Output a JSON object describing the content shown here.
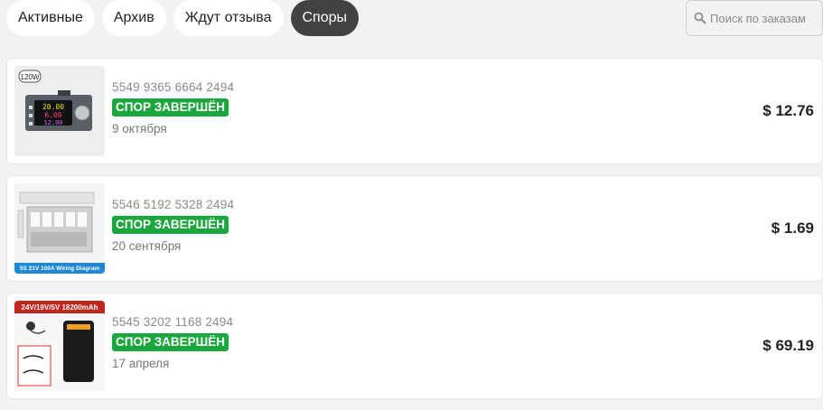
{
  "tabs": [
    {
      "label": "Активные"
    },
    {
      "label": "Архив"
    },
    {
      "label": "Ждут отзыва"
    },
    {
      "label": "Споры"
    }
  ],
  "search": {
    "placeholder": "Поиск по заказам"
  },
  "orders": [
    {
      "number": "5549 9365 6664 2494",
      "status": "СПОР ЗАВЕРШЁН",
      "date": "9 октября",
      "price": "$ 12.76",
      "image_label": "120W",
      "image_readouts": [
        "20.00",
        "6.00",
        "12.00"
      ]
    },
    {
      "number": "5546 5192 5328 2494",
      "status": "СПОР ЗАВЕРШЁН",
      "date": "20 сентября",
      "price": "$ 1.69",
      "image_label": "5S 21V 100A Wiring Diagram"
    },
    {
      "number": "5545 3202 1168 2494",
      "status": "СПОР ЗАВЕРШЁН",
      "date": "17 апреля",
      "price": "$ 69.19",
      "image_label": "24V/19V/5V 18200mAh"
    }
  ],
  "colors": {
    "active_tab": "#424242",
    "badge": "#1ba73d",
    "background": "#f2f2f2"
  }
}
